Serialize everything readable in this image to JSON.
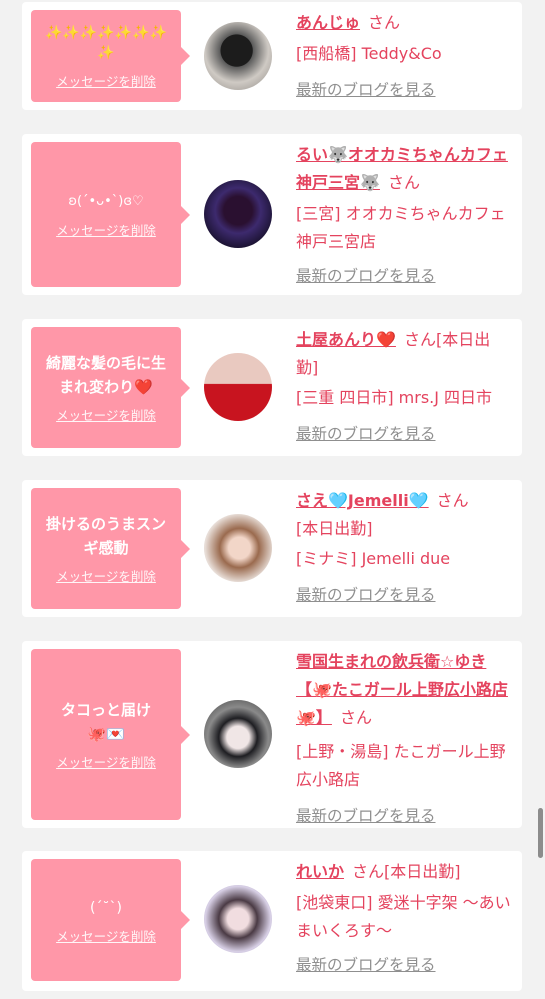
{
  "common": {
    "delete_label": "メッセージを削除",
    "blog_label": "最新のブログを見る",
    "san_label": "さん"
  },
  "colors": {
    "bubble": "#ff97a8",
    "accent": "#e4435e",
    "page_bg": "#f2f2f2"
  },
  "messages": [
    {
      "message": "✨✨✨✨✨✨✨✨",
      "name": "あんじゅ",
      "suffix": "",
      "shop": "[西船橋] Teddy&Co"
    },
    {
      "message": "ʚ(ˊ•ᴗ•ˋ)ɞ♡",
      "name": "るい🐺オオカミちゃんカフェ神戸三宮🐺",
      "suffix": "",
      "shop": "[三宮] オオカミちゃんカフェ神戸三宮店"
    },
    {
      "message": "綺麗な髪の毛に生まれ変わり❤️",
      "name": "土屋あんり❤️",
      "suffix": "[本日出勤]",
      "shop": "[三重 四日市] mrs.J 四日市"
    },
    {
      "message": "掛けるのうまスンギ感動",
      "name": "さえ🩵Jemelli🩵",
      "suffix": "[本日出勤]",
      "shop": "[ミナミ] Jemelli due"
    },
    {
      "message": "タコっと届け🐙💌",
      "name": "雪国生まれの飲兵衛☆ゆき【🐙たこガール上野広小路店🐙】",
      "suffix": "",
      "shop": "[上野・湯島] たこガール上野広小路店"
    },
    {
      "message": "(ˊ˘ˋ)",
      "name": "れいか",
      "suffix": "[本日出勤]",
      "shop": "[池袋東口] 愛迷十字架 〜あいまいくろす〜"
    }
  ]
}
